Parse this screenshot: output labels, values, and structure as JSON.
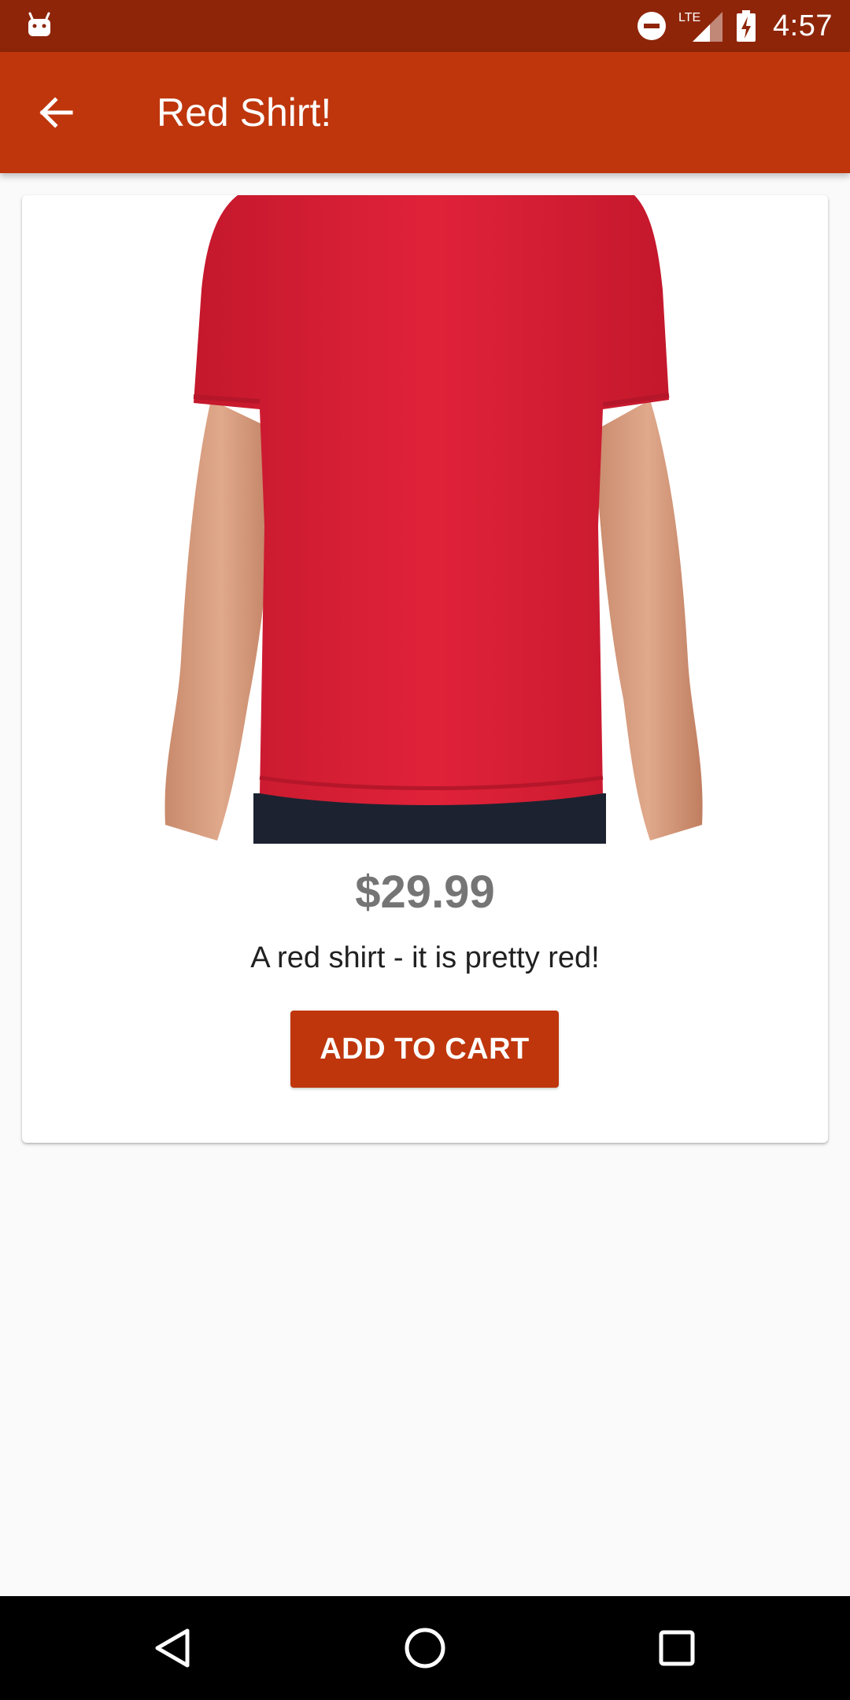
{
  "status_bar": {
    "time": "4:57",
    "network_label": "LTE",
    "icons": [
      "android-icon",
      "do-not-disturb-icon",
      "signal-icon",
      "battery-charging-icon"
    ]
  },
  "app_bar": {
    "title": "Red Shirt!",
    "back_icon": "arrow-back-icon",
    "background_color": "#bf360c"
  },
  "product": {
    "image_alt": "red-shirt-photo",
    "price": "$29.99",
    "description": "A red shirt - it is pretty red!",
    "add_to_cart_label": "ADD TO CART"
  },
  "nav_bar": {
    "icons": [
      "back-triangle-icon",
      "home-circle-icon",
      "recents-square-icon"
    ]
  },
  "colors": {
    "status_bar": "#8e2509",
    "accent": "#bf360c",
    "shirt": "#d91f35",
    "price_text": "#757575"
  }
}
